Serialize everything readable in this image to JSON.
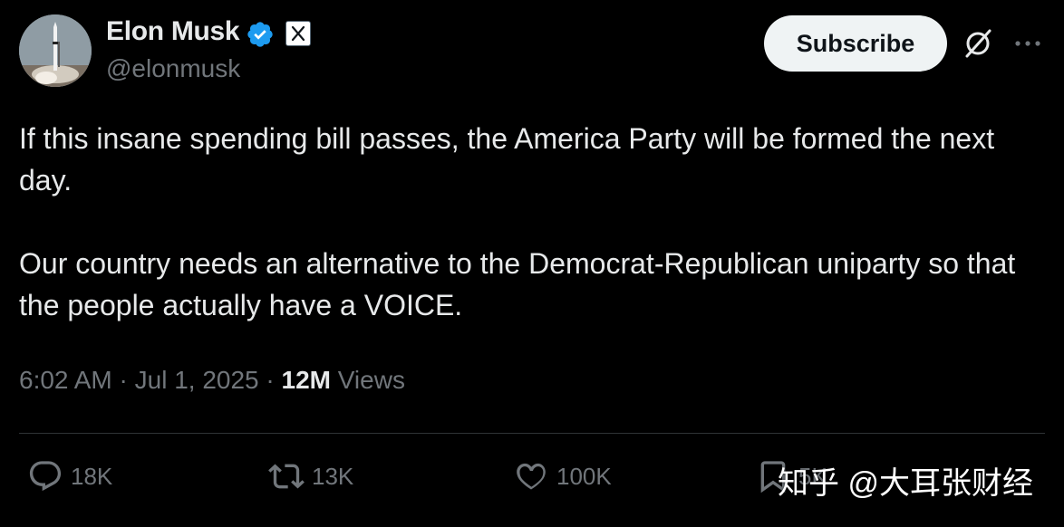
{
  "author": {
    "display_name": "Elon Musk",
    "handle": "@elonmusk",
    "verified_badge": "verified-check-icon",
    "affiliation_badge": "x-logo-icon"
  },
  "header": {
    "subscribe_label": "Subscribe",
    "grok_icon": "grok-icon",
    "more_icon": "more-horizontal-icon"
  },
  "tweet": {
    "paragraphs": [
      "If this insane spending bill passes, the America Party will be formed the next day.",
      "Our country needs an alternative to the Democrat-Republican uniparty so that the people actually have a VOICE."
    ],
    "time": "6:02 AM",
    "date": "Jul 1, 2025",
    "separator": "·",
    "views_count": "12M",
    "views_label": "Views"
  },
  "actions": {
    "replies": "18K",
    "reposts": "13K",
    "likes": "100K",
    "bookmarks": "5K"
  },
  "watermark": "知乎 @大耳张财经",
  "colors": {
    "background": "#000000",
    "text_primary": "#e7e9ea",
    "text_secondary": "#71767b",
    "verified_blue": "#1d9bf0",
    "button_bg": "#eff3f4",
    "divider": "#2f3336"
  }
}
